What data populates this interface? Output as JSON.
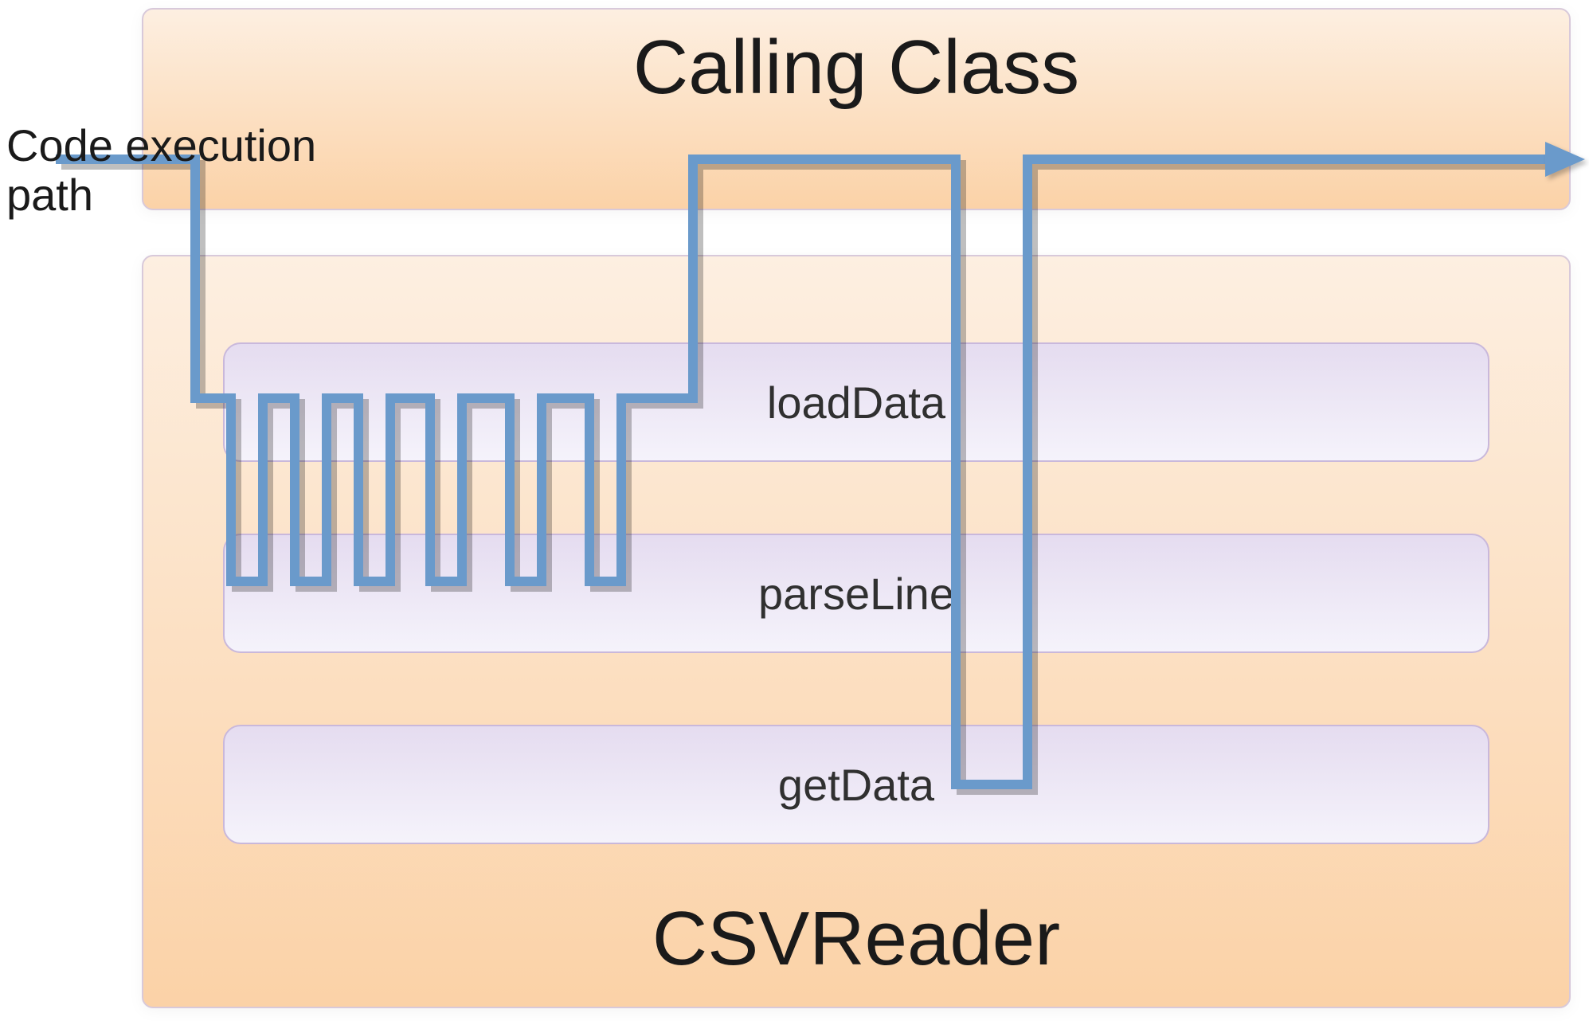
{
  "diagram": {
    "calling_class_title": "Calling Class",
    "csvreader_title": "CSVReader",
    "execution_label_line1": "Code execution",
    "execution_label_line2": "path",
    "methods": {
      "loadData": "loadData",
      "parseLine": "parseLine",
      "getData": "getData"
    }
  }
}
